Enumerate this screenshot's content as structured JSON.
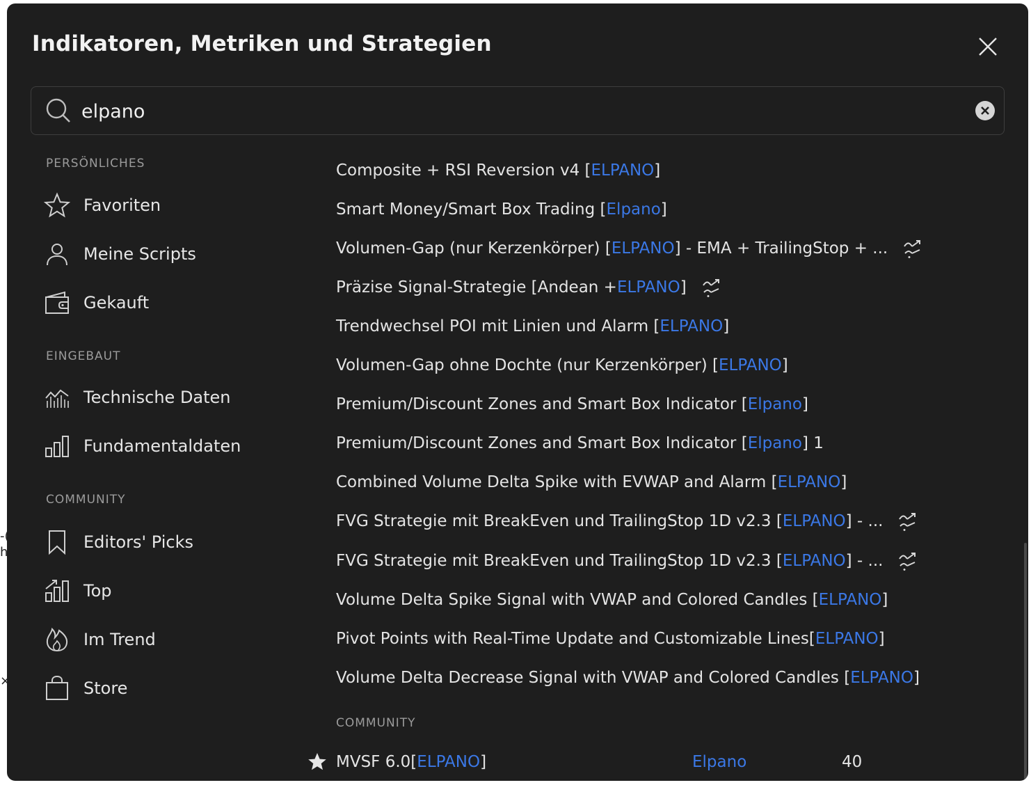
{
  "dialog": {
    "title": "Indikatoren, Metriken und Strategien"
  },
  "search": {
    "value": "elpano"
  },
  "sidebar": {
    "sections": [
      {
        "label": "PERSÖNLICHES"
      },
      {
        "label": "EINGEBAUT"
      },
      {
        "label": "COMMUNITY"
      }
    ],
    "items": [
      {
        "label": "Favoriten",
        "icon": "star-icon"
      },
      {
        "label": "Meine Scripts",
        "icon": "user-icon"
      },
      {
        "label": "Gekauft",
        "icon": "wallet-icon"
      },
      {
        "label": "Technische Daten",
        "icon": "chart-area-icon"
      },
      {
        "label": "Fundamentaldaten",
        "icon": "bar-chart-icon"
      },
      {
        "label": "Editors' Picks",
        "icon": "bookmark-icon"
      },
      {
        "label": "Top",
        "icon": "top-chart-icon"
      },
      {
        "label": "Im Trend",
        "icon": "flame-icon"
      },
      {
        "label": "Store",
        "icon": "shopping-bag-icon"
      }
    ]
  },
  "results": [
    {
      "pre": "Composite + RSI Reversion v4 [",
      "author": "ELPANO",
      "post": "]",
      "strategy": false
    },
    {
      "pre": "Smart Money/Smart Box Trading [",
      "author": "Elpano",
      "post": "]",
      "strategy": false
    },
    {
      "pre": "Volumen-Gap (nur Kerzenkörper) [",
      "author": "ELPANO",
      "post": "] - EMA + TrailingStop + ...",
      "strategy": true
    },
    {
      "pre": "Präzise Signal-Strategie [Andean + ",
      "author": "ELPANO",
      "post": "]",
      "strategy": true
    },
    {
      "pre": "Trendwechsel POI mit Linien und Alarm [",
      "author": "ELPANO",
      "post": "]",
      "strategy": false
    },
    {
      "pre": "Volumen-Gap ohne Dochte (nur Kerzenkörper) [",
      "author": "ELPANO",
      "post": "]",
      "strategy": false
    },
    {
      "pre": "Premium/Discount Zones and Smart Box Indicator [",
      "author": "Elpano",
      "post": "]",
      "strategy": false
    },
    {
      "pre": "Premium/Discount Zones and Smart Box Indicator [",
      "author": "Elpano",
      "post": "] 1",
      "strategy": false
    },
    {
      "pre": "Combined Volume Delta Spike with EVWAP and Alarm [",
      "author": "ELPANO",
      "post": "]",
      "strategy": false
    },
    {
      "pre": "FVG Strategie mit BreakEven und TrailingStop 1D v2.3 [",
      "author": "ELPANO",
      "post": "] - ...",
      "strategy": true
    },
    {
      "pre": "FVG Strategie mit BreakEven und TrailingStop 1D v2.3 [",
      "author": "ELPANO",
      "post": "] - ...",
      "strategy": true
    },
    {
      "pre": "Volume Delta Spike Signal with VWAP and Colored Candles [",
      "author": "ELPANO",
      "post": "]",
      "strategy": false
    },
    {
      "pre": "Pivot Points with Real-Time Update and Customizable Lines[",
      "author": "ELPANO",
      "post": "]",
      "strategy": false
    },
    {
      "pre": "Volume Delta Decrease Signal with VWAP and Colored Candles [",
      "author": "ELPANO",
      "post": "]",
      "strategy": false
    }
  ],
  "community": {
    "heading": "COMMUNITY",
    "rows": [
      {
        "pre": "MVSF 6.0[",
        "author": "ELPANO",
        "post": "]",
        "creator": "Elpano",
        "count": "40",
        "favorite": true
      }
    ]
  },
  "colors": {
    "background": "#1e1e1e",
    "author_link": "#3b78e6",
    "text": "#e4e4e4",
    "muted": "#9b9b9b"
  }
}
